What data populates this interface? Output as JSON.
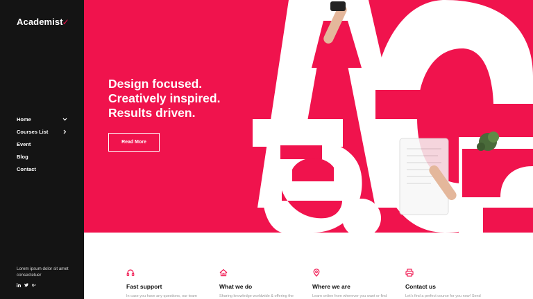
{
  "brand": {
    "name": "Academist",
    "accent_mark": "✓",
    "accent_color": "#f0134d"
  },
  "sidebar": {
    "nav": [
      {
        "label": "Home",
        "has_dropdown": true
      },
      {
        "label": "Courses List",
        "has_submenu": true
      },
      {
        "label": "Event"
      },
      {
        "label": "Blog"
      },
      {
        "label": "Contact"
      }
    ],
    "footer_text": "Lorem ipsum dolor sit amet consectetuer",
    "socials": [
      "linkedin-icon",
      "twitter-icon",
      "google-plus-icon"
    ]
  },
  "hero": {
    "background": "#f0134d",
    "headline_lines": [
      "Design focused.",
      "Creatively inspired.",
      "Results driven."
    ],
    "button_label": "Read More",
    "big_letters": "ACe B"
  },
  "features": [
    {
      "icon": "headphones-icon",
      "title": "Fast support",
      "text": "In case you have any questions, our team"
    },
    {
      "icon": "home-icon",
      "title": "What we do",
      "text": "Sharing knowledge worldwide & offering the"
    },
    {
      "icon": "map-pin-icon",
      "title": "Where we are",
      "text": "Learn online from wherever you want or find"
    },
    {
      "icon": "printer-icon",
      "title": "Contact us",
      "text": "Let's find a perfect course for you now! Send"
    }
  ]
}
